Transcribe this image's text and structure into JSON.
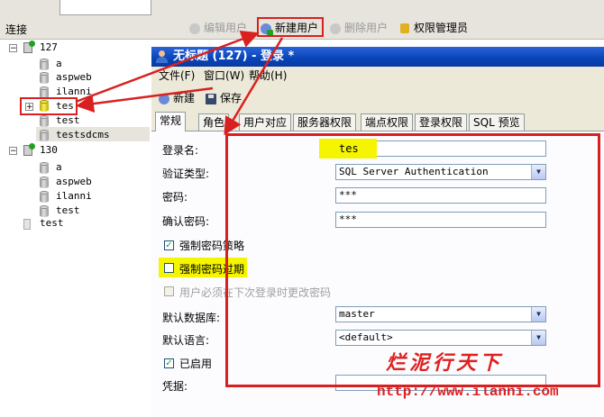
{
  "top_toolbar": {
    "connection_label": "连接",
    "edit_user": "编辑用户",
    "new_user": "新建用户",
    "delete_user": "删除用户",
    "permission_manager": "权限管理员"
  },
  "tree": {
    "server1": "127",
    "server1_dbs": [
      "a",
      "aspweb",
      "ilanni",
      "tes",
      "test",
      "testsdcms"
    ],
    "server2": "130",
    "server2_dbs": [
      "a",
      "aspweb",
      "ilanni",
      "test"
    ],
    "server3": "test"
  },
  "dialog": {
    "title": "无标题 (127) - 登录 *",
    "menu": [
      "文件(F)",
      "窗口(W)",
      "帮助(H)"
    ],
    "toolbar_new": "新建",
    "toolbar_save": "保存",
    "tabs": [
      "常规",
      "角色",
      "用户对应",
      "服务器权限",
      "端点权限",
      "登录权限",
      "SQL 预览"
    ],
    "form": {
      "login_name_label": "登录名:",
      "login_name_value": "tes",
      "auth_type_label": "验证类型:",
      "auth_type_value": "SQL Server Authentication",
      "password_label": "密码:",
      "password_value": "***",
      "confirm_password_label": "确认密码:",
      "confirm_password_value": "***",
      "enforce_policy_label": "强制密码策略",
      "enforce_expiration_label": "强制密码过期",
      "must_change_label": "用户必须在下次登录时更改密码",
      "default_db_label": "默认数据库:",
      "default_db_value": "master",
      "default_lang_label": "默认语言:",
      "default_lang_value": "<default>",
      "enabled_label": "已启用",
      "credential_label": "凭据:"
    }
  },
  "watermark": {
    "text": "烂泥行天下",
    "url": "http://www.ilanni.com"
  },
  "colors": {
    "annotation_red": "#d92020",
    "highlight_yellow": "#f5f500",
    "title_blue": "#0844b8"
  }
}
